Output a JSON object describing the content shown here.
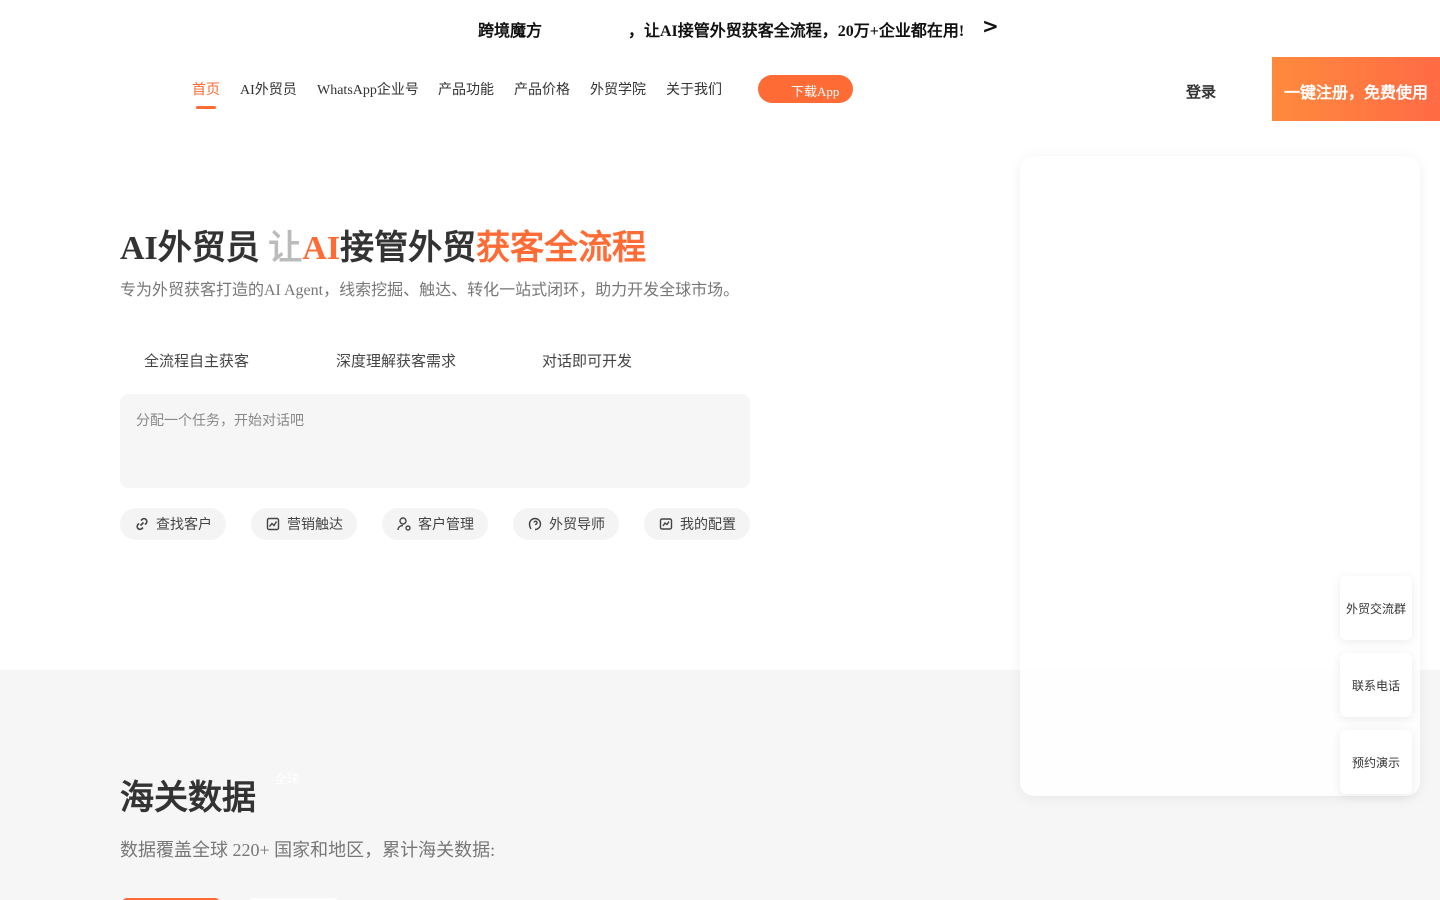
{
  "announcement": {
    "brand": "跨境魔方",
    "message": "，让AI接管外贸获客全流程，20万+企业都在用!",
    "arrow": ">"
  },
  "nav": {
    "items": [
      "首页",
      "AI外贸员",
      "WhatsApp企业号",
      "产品功能",
      "产品价格",
      "外贸学院",
      "关于我们"
    ],
    "active_index": 0,
    "download_app": "下载App",
    "login": "登录",
    "register": "一键注册，免费使用"
  },
  "hero": {
    "title_part1": "AI外贸员",
    "title_typing": "让",
    "title_ai": "AI",
    "title_part2": "接管外贸",
    "title_accent": "获客全流程",
    "subtitle": "专为外贸获客打造的AI Agent，线索挖掘、触达、转化一站式闭环，助力开发全球市场。",
    "features": [
      "全流程自主获客",
      "深度理解获客需求",
      "对话即可开发"
    ],
    "task_placeholder": "分配一个任务，开始对话吧",
    "chips": [
      {
        "label": "查找客户",
        "icon": "link-icon"
      },
      {
        "label": "营销触达",
        "icon": "chart-icon"
      },
      {
        "label": "客户管理",
        "icon": "user-icon"
      },
      {
        "label": "外贸导师",
        "icon": "mentor-icon"
      },
      {
        "label": "我的配置",
        "icon": "config-icon"
      }
    ]
  },
  "customs": {
    "title": "海关数据",
    "ghost_label": "全球",
    "description": "数据覆盖全球 220+ 国家和地区，累计海关数据:"
  },
  "side_buttons": [
    "外贸交流群",
    "联系电话",
    "预约演示"
  ],
  "colors": {
    "accent": "#ff6b35",
    "gray_bg": "#f6f6f6"
  }
}
